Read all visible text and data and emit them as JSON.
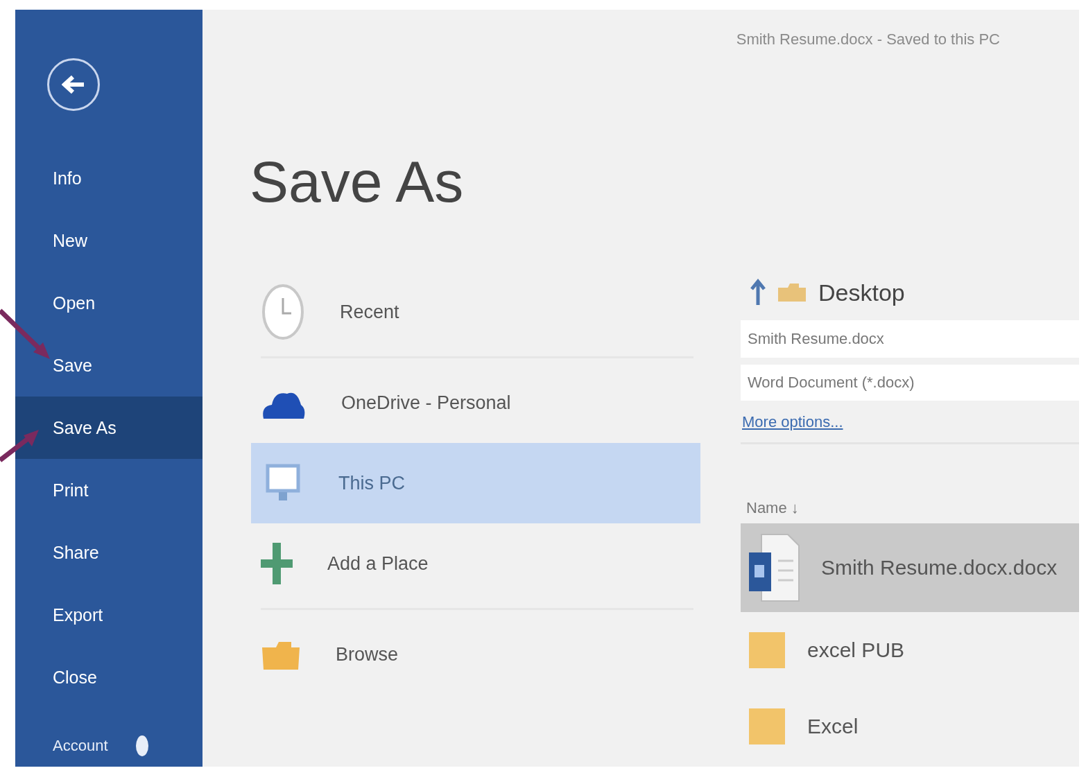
{
  "document_title": "Smith Resume.docx  -  Saved to this PC",
  "sidebar": {
    "items": [
      {
        "label": "Info",
        "selected": false
      },
      {
        "label": "New",
        "selected": false
      },
      {
        "label": "Open",
        "selected": false
      },
      {
        "label": "Save",
        "selected": false
      },
      {
        "label": "Save As",
        "selected": true
      },
      {
        "label": "Print",
        "selected": false
      },
      {
        "label": "Share",
        "selected": false
      },
      {
        "label": "Export",
        "selected": false
      },
      {
        "label": "Close",
        "selected": false
      }
    ],
    "account": {
      "label": "Account"
    }
  },
  "page_title": "Save As",
  "places": [
    {
      "kind": "recent",
      "label": "Recent",
      "selected": false
    },
    {
      "kind": "onedrive",
      "label": "OneDrive - Personal",
      "selected": false
    },
    {
      "kind": "pc",
      "label": "This PC",
      "selected": true
    },
    {
      "kind": "add",
      "label": "Add a Place",
      "selected": false
    },
    {
      "kind": "browse",
      "label": "Browse",
      "selected": false
    }
  ],
  "location": {
    "folder": "Desktop"
  },
  "file_name": {
    "value": "Smith Resume.docx"
  },
  "file_type": {
    "value": "Word Document (*.docx)"
  },
  "more_options": "More options...",
  "file_list": {
    "sort_header": "Name ↓",
    "items": [
      {
        "kind": "document",
        "name": "Smith Resume.docx.docx",
        "selected": true
      },
      {
        "kind": "folder",
        "name": "excel PUB",
        "selected": false
      },
      {
        "kind": "folder",
        "name": "Excel",
        "selected": false
      }
    ]
  }
}
